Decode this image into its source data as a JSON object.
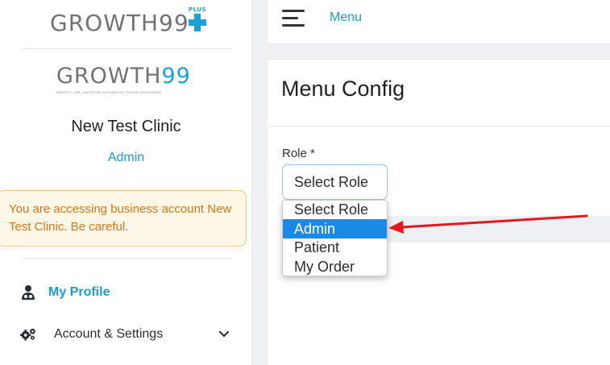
{
  "sidebar": {
    "brand_top": {
      "wordmark": "GROWTH99",
      "plus_text": "PLUS"
    },
    "brand_second": {
      "wordmark_main": "GROWTH",
      "wordmark_accent": "99",
      "tagline": "WEBSITE | CRM | MARKETING AUTOMATION | PATIENT ENGAGEMENT"
    },
    "clinic_name": "New Test Clinic",
    "role": "Admin",
    "warning": "You are accessing business account New Test Clinic. Be careful.",
    "nav": [
      {
        "label": "My Profile",
        "icon": "user-doctor-icon"
      },
      {
        "label": "Account & Settings",
        "icon": "gears-icon"
      }
    ]
  },
  "topbar": {
    "breadcrumb": "Menu"
  },
  "main": {
    "title": "Menu Config",
    "role_label": "Role *",
    "role_select_value": "Select Role",
    "role_options": [
      "Select Role",
      "Admin",
      "Patient",
      "My Order"
    ],
    "selected_option": "Admin"
  },
  "colors": {
    "accent": "#1a9ad6",
    "warning_text": "#d4761a",
    "warning_bg": "#fcf7e6",
    "selected_option_bg": "#1a8ae6",
    "annotation_arrow": "#e8161d"
  }
}
